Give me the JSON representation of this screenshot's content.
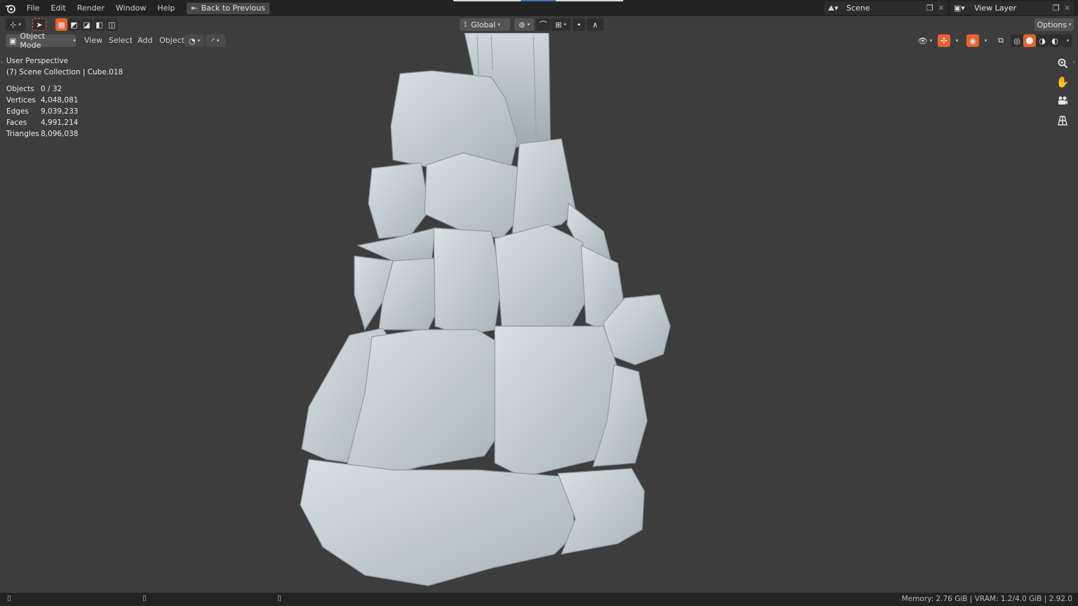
{
  "menu": {
    "file": "File",
    "edit": "Edit",
    "render": "Render",
    "window": "Window",
    "help": "Help",
    "back_to_previous": "Back to Previous"
  },
  "scene": {
    "label": "Scene"
  },
  "view_layer": {
    "label": "View Layer"
  },
  "toolbar": {
    "orientation": "Global",
    "options": "Options"
  },
  "header": {
    "mode": "Object Mode",
    "view": "View",
    "select": "Select",
    "add": "Add",
    "object": "Object"
  },
  "viewport": {
    "perspective": "User Perspective",
    "collection": "(7) Scene Collection | Cube.018"
  },
  "stats": [
    {
      "label": "Objects",
      "value": "0 / 32"
    },
    {
      "label": "Vertices",
      "value": "4,048,081"
    },
    {
      "label": "Edges",
      "value": "9,039,233"
    },
    {
      "label": "Faces",
      "value": "4,991,214"
    },
    {
      "label": "Triangles",
      "value": "8,096,038"
    }
  ],
  "statusbar": {
    "info": "Memory: 2.76 GiB | VRAM: 1.2/4.0 GiB | 2.92.0"
  },
  "colors": {
    "accent_select": "#e8622f",
    "active_shading": "#f0f0f0",
    "rock": "#c5cdd2"
  }
}
